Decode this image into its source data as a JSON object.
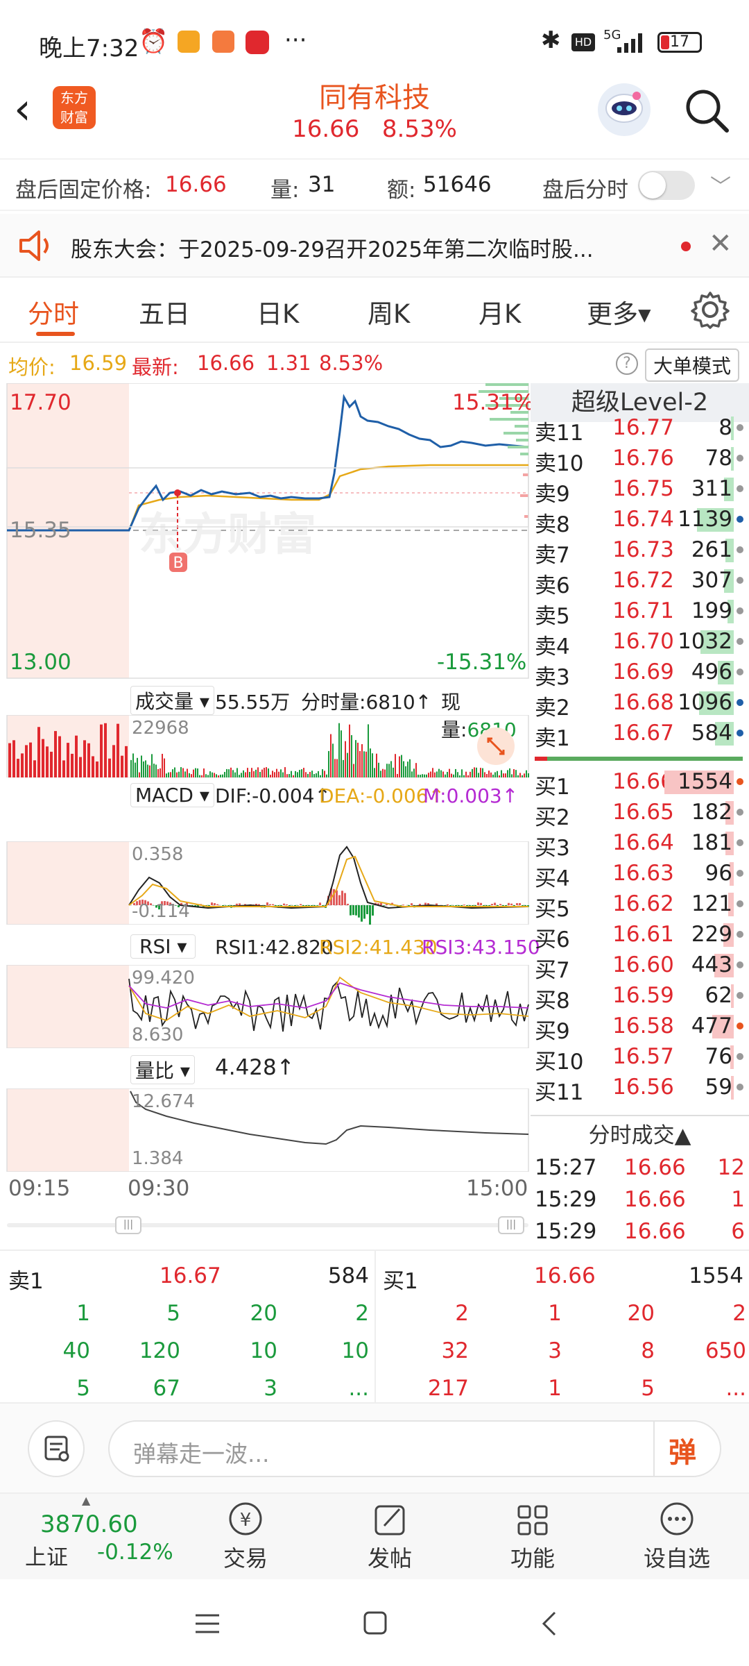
{
  "status": {
    "time": "晚上7:32",
    "signal": "5G",
    "battery": "17"
  },
  "header": {
    "logo_line1": "东方",
    "logo_line2": "财富",
    "title": "同有科技",
    "price": "16.66",
    "change_pct": "8.53%"
  },
  "infobar": {
    "fixed_label": "盘后固定价格:",
    "fixed_value": "16.66",
    "vol_label": "量:",
    "vol_value": "31",
    "amt_label": "额:",
    "amt_value": "51646",
    "after_label": "盘后分时"
  },
  "notice": {
    "text": "股东大会：于2025-09-29召开2025年第二次临时股..."
  },
  "tabs": [
    "分时",
    "五日",
    "日K",
    "周K",
    "月K",
    "更多▾"
  ],
  "chartinfo": {
    "avg_label": "均价:",
    "avg_value": "16.59",
    "latest_label": "最新:",
    "latest_value": "16.66",
    "change": "1.31",
    "pct": "8.53%",
    "big_order": "大单模式"
  },
  "price_chart": {
    "top": "17.70",
    "mid": "15.35",
    "bottom": "13.00",
    "top_pct": "15.31%",
    "bottom_pct": "-15.31%",
    "marker": "B",
    "watermark": "东方财富"
  },
  "volume": {
    "label": "成交量",
    "total": "55.55万",
    "fen_label": "分时量:",
    "fen_value": "6810",
    "now_label": "现量:",
    "now_value": "6810",
    "max": "22968"
  },
  "macd": {
    "label": "MACD",
    "dif": "DIF:-0.004↑",
    "dea": "DEA:-0.006↑",
    "m": "M:0.003↑",
    "top": "0.358",
    "bottom": "-0.114"
  },
  "rsi": {
    "label": "RSI",
    "rsi1": "RSI1:42.820",
    "rsi2": "RSI2:41.430",
    "rsi3": "RSI3:43.150",
    "top": "99.420",
    "bottom": "8.630"
  },
  "liangbi": {
    "label": "量比",
    "value": "4.428↑",
    "top": "12.674",
    "bottom": "1.384"
  },
  "time_axis": {
    "start": "09:15",
    "open": "09:30",
    "end": "15:00"
  },
  "orderbook": {
    "title": "超级Level-2",
    "sells": [
      {
        "label": "卖11",
        "price": "16.77",
        "vol": "8",
        "bar": 0.01
      },
      {
        "label": "卖10",
        "price": "16.76",
        "vol": "78",
        "bar": 0.05
      },
      {
        "label": "卖9",
        "price": "16.75",
        "vol": "311",
        "bar": 0.2
      },
      {
        "label": "卖8",
        "price": "16.74",
        "vol": "1139",
        "bar": 0.73
      },
      {
        "label": "卖7",
        "price": "16.73",
        "vol": "261",
        "bar": 0.17
      },
      {
        "label": "卖6",
        "price": "16.72",
        "vol": "307",
        "bar": 0.2
      },
      {
        "label": "卖5",
        "price": "16.71",
        "vol": "199",
        "bar": 0.13
      },
      {
        "label": "卖4",
        "price": "16.70",
        "vol": "1032",
        "bar": 0.66
      },
      {
        "label": "卖3",
        "price": "16.69",
        "vol": "496",
        "bar": 0.32
      },
      {
        "label": "卖2",
        "price": "16.68",
        "vol": "1096",
        "bar": 0.7
      },
      {
        "label": "卖1",
        "price": "16.67",
        "vol": "584",
        "bar": 0.37
      }
    ],
    "buys": [
      {
        "label": "买1",
        "price": "16.66",
        "vol": "1554",
        "bar": 1.0
      },
      {
        "label": "买2",
        "price": "16.65",
        "vol": "182",
        "bar": 0.12
      },
      {
        "label": "买3",
        "price": "16.64",
        "vol": "181",
        "bar": 0.12
      },
      {
        "label": "买4",
        "price": "16.63",
        "vol": "96",
        "bar": 0.06
      },
      {
        "label": "买5",
        "price": "16.62",
        "vol": "121",
        "bar": 0.08
      },
      {
        "label": "买6",
        "price": "16.61",
        "vol": "229",
        "bar": 0.15
      },
      {
        "label": "买7",
        "price": "16.60",
        "vol": "443",
        "bar": 0.28
      },
      {
        "label": "买8",
        "price": "16.59",
        "vol": "62",
        "bar": 0.04
      },
      {
        "label": "买9",
        "price": "16.58",
        "vol": "477",
        "bar": 0.31
      },
      {
        "label": "买10",
        "price": "16.57",
        "vol": "76",
        "bar": 0.05
      },
      {
        "label": "买11",
        "price": "16.56",
        "vol": "59",
        "bar": 0.04
      }
    ],
    "trades_title": "分时成交▲",
    "trades": [
      {
        "time": "15:27",
        "price": "16.66",
        "vol": "12"
      },
      {
        "time": "15:29",
        "price": "16.66",
        "vol": "1"
      },
      {
        "time": "15:29",
        "price": "16.66",
        "vol": "6"
      }
    ]
  },
  "bottom_table": {
    "sell_label": "卖1",
    "sell_price": "16.67",
    "sell_vol": "584",
    "buy_label": "买1",
    "buy_price": "16.66",
    "buy_vol": "1554",
    "sell_rows": [
      [
        "1",
        "5",
        "20",
        "2"
      ],
      [
        "40",
        "120",
        "10",
        "10"
      ],
      [
        "5",
        "67",
        "3",
        "..."
      ]
    ],
    "buy_rows": [
      [
        "2",
        "1",
        "20",
        "2"
      ],
      [
        "32",
        "3",
        "8",
        "650"
      ],
      [
        "217",
        "1",
        "5",
        "..."
      ]
    ]
  },
  "danmu": {
    "placeholder": "弹幕走一波...",
    "send": "弹"
  },
  "bottom_nav": {
    "index_value": "3870.60",
    "index_name": "上证",
    "index_change": "-0.12%",
    "items": [
      "交易",
      "发帖",
      "功能",
      "设自选"
    ]
  },
  "colors": {
    "red": "#e0282e",
    "green": "#1a9a3c",
    "gold": "#e6a817",
    "blue": "#1f5fa8",
    "orange": "#e8541e"
  }
}
